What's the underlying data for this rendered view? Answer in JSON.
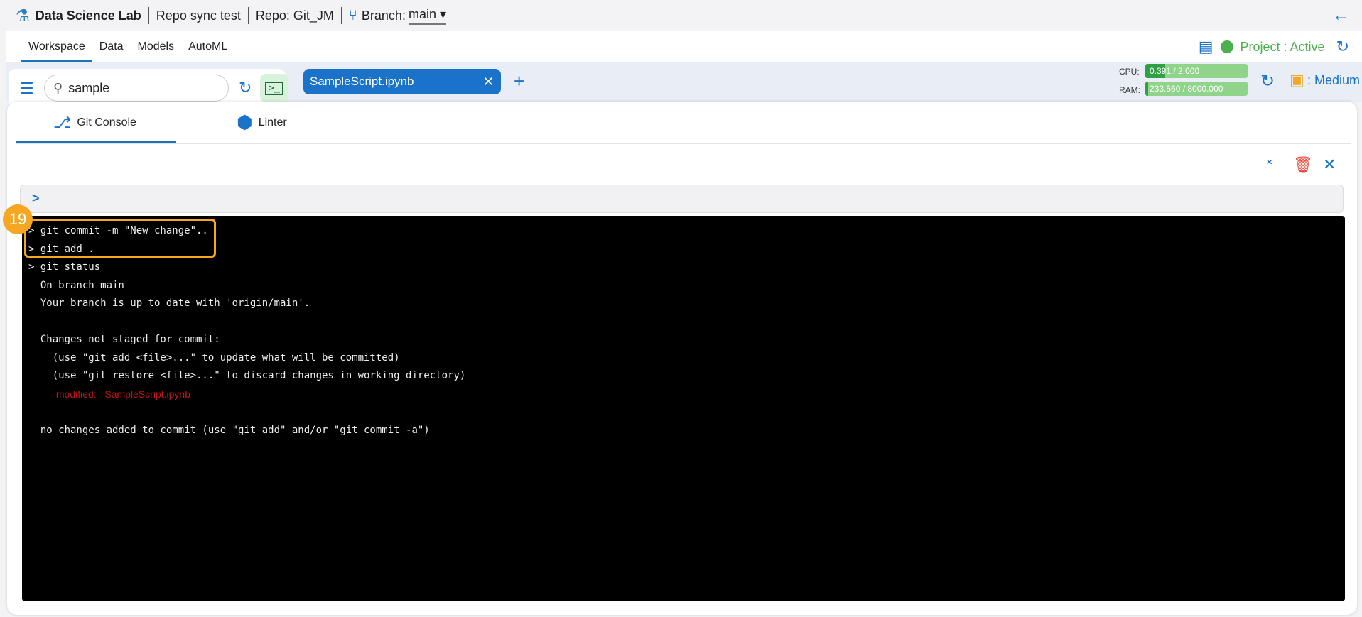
{
  "header": {
    "app_title": "Data Science Lab",
    "project": "Repo sync test",
    "repo": "Repo: Git_JM",
    "branch_label": "Branch:",
    "branch": "main"
  },
  "nav": {
    "tabs": [
      "Workspace",
      "Data",
      "Models",
      "AutoML"
    ],
    "active": "Workspace",
    "project_status": "Project : Active",
    "status_color": "#4caf50"
  },
  "toolbar": {
    "search_value": "sample",
    "open_file": "SampleScript.ipynb",
    "cpu_label": "CPU:",
    "cpu_value": "0.391 / 2.000",
    "cpu_fraction": 0.1955,
    "ram_label": "RAM:",
    "ram_value": "233.560 / 8000.000",
    "ram_fraction": 0.0292,
    "resource_size": ": Medium"
  },
  "panel": {
    "tabs": [
      "Git Console",
      "Linter"
    ],
    "active": "Git Console",
    "input_prompt": ">"
  },
  "terminal": {
    "lines": [
      {
        "text": "> git commit -m \"New change\"..",
        "type": "cmd"
      },
      {
        "text": "> git add .",
        "type": "cmd"
      },
      {
        "text": "> git status",
        "type": "cmd"
      },
      {
        "text": "  On branch main",
        "type": "out"
      },
      {
        "text": "  Your branch is up to date with 'origin/main'.",
        "type": "out"
      },
      {
        "text": "",
        "type": "out"
      },
      {
        "text": "  Changes not staged for commit:",
        "type": "out"
      },
      {
        "text": "    (use \"git add <file>...\" to update what will be committed)",
        "type": "out"
      },
      {
        "text": "    (use \"git restore <file>...\" to discard changes in working directory)",
        "type": "out"
      },
      {
        "text": "          modified:   SampleScript.ipynb",
        "type": "modified"
      },
      {
        "text": "",
        "type": "out"
      },
      {
        "text": "  no changes added to commit (use \"git add\" and/or \"git commit -a\")",
        "type": "out"
      }
    ]
  },
  "annotation": {
    "step": "19",
    "color": "#f5a623"
  }
}
